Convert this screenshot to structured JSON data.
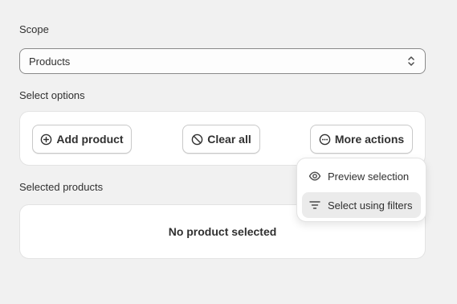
{
  "scope": {
    "label": "Scope",
    "selected_value": "Products"
  },
  "options": {
    "label": "Select options",
    "add_label": "Add product",
    "clear_label": "Clear all",
    "more_label": "More actions"
  },
  "dropdown": {
    "items": [
      {
        "label": "Preview selection",
        "icon": "eye-icon"
      },
      {
        "label": "Select using filters",
        "icon": "filter-icon"
      }
    ]
  },
  "selected": {
    "label": "Selected products",
    "empty_text": "No product selected"
  },
  "colors": {
    "background": "#f1f1f1",
    "card": "#ffffff",
    "text": "#303030",
    "hover": "#ebebeb"
  }
}
